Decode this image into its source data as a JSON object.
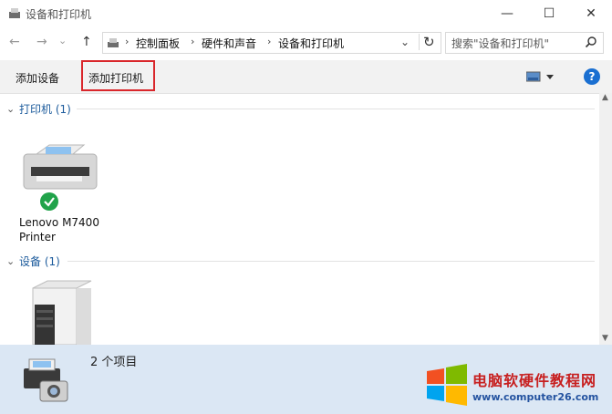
{
  "window": {
    "title": "设备和打印机",
    "controls": {
      "minimize": "—",
      "maximize": "☐",
      "close": "✕"
    }
  },
  "nav": {
    "back": "←",
    "forward": "→",
    "dropdown": "⌄",
    "up": "↑",
    "breadcrumb": [
      "控制面板",
      "硬件和声音",
      "设备和打印机"
    ],
    "separator": "›",
    "address_dropdown": "⌄",
    "refresh": "↻",
    "search_placeholder": "搜索\"设备和打印机\""
  },
  "toolbar": {
    "add_device": "添加设备",
    "add_printer": "添加打印机",
    "help": "?"
  },
  "groups": [
    {
      "header": "打印机 (1)",
      "items": [
        {
          "label_line1": "Lenovo M7400",
          "label_line2": "Printer",
          "status": "ok"
        }
      ]
    },
    {
      "header": "设备 (1)",
      "items": [
        {
          "label_line1": "",
          "label_line2": ""
        }
      ]
    }
  ],
  "status_bar": {
    "count_text": "2 个项目"
  },
  "watermark": {
    "title": "电脑软硬件教程网",
    "url": "www.computer26.com"
  },
  "colors": {
    "highlight": "#d9262b",
    "group_header": "#1c5b9c",
    "status_bg": "#dbe7f4"
  }
}
